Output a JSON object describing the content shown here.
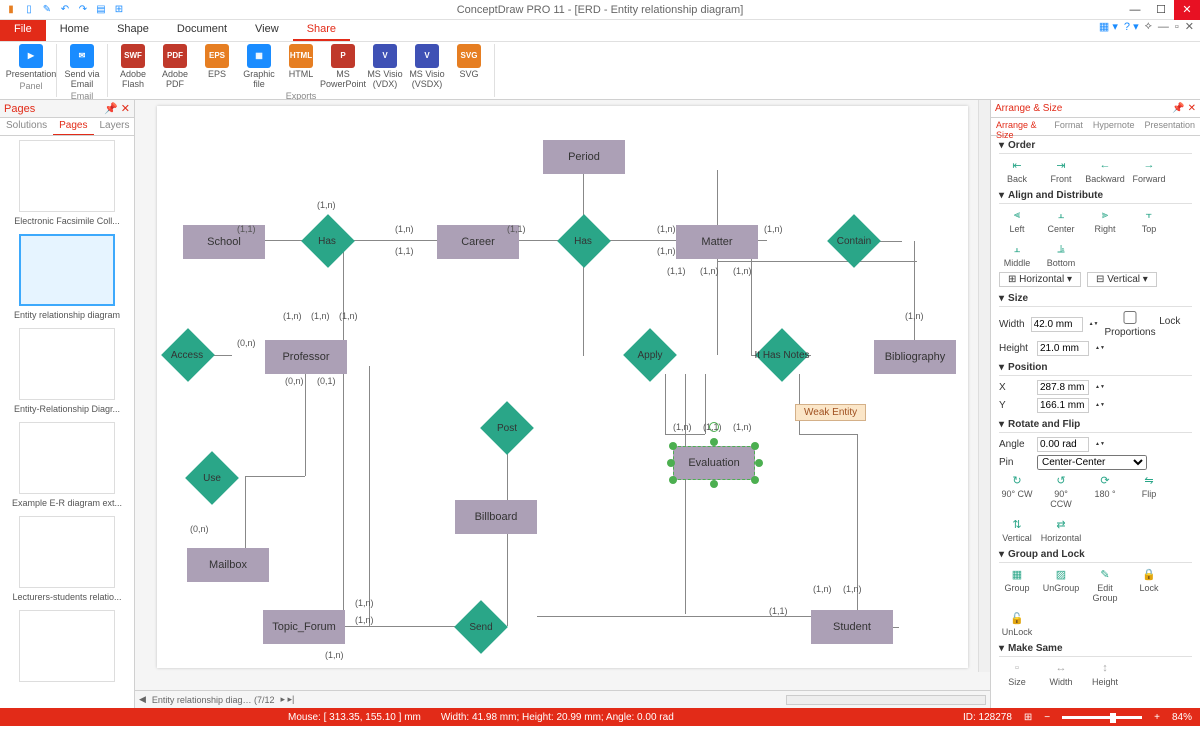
{
  "title": "ConceptDraw PRO 11 - [ERD - Entity relationship diagram]",
  "menu": {
    "file": "File",
    "home": "Home",
    "shape": "Shape",
    "document": "Document",
    "view": "View",
    "share": "Share"
  },
  "ribbon": {
    "presentation": "Presentation",
    "panel": "Panel",
    "sendemail": "Send via Email",
    "email": "Email",
    "flash": "Adobe Flash",
    "pdf": "Adobe PDF",
    "eps": "EPS",
    "graphic": "Graphic file",
    "html": "HTML",
    "ppt": "MS PowerPoint",
    "vdx": "MS Visio (VDX)",
    "vsdx": "MS Visio (VSDX)",
    "svg": "SVG",
    "exports": "Exports"
  },
  "pages": {
    "title": "Pages",
    "tabs": {
      "solutions": "Solutions",
      "pages": "Pages",
      "layers": "Layers"
    },
    "thumbs": [
      "Electronic Facsimile Coll...",
      "Entity relationship diagram",
      "Entity-Relationship Diagr...",
      "Example E-R diagram ext...",
      "Lecturers-students relatio..."
    ]
  },
  "diagram": {
    "entities": {
      "school": "School",
      "period": "Period",
      "career": "Career",
      "matter": "Matter",
      "professor": "Professor",
      "bibliography": "Bibliography",
      "evaluation": "Evaluation",
      "billboard": "Billboard",
      "mailbox": "Mailbox",
      "topic": "Topic_Forum",
      "student": "Student"
    },
    "relations": {
      "has1": "Has",
      "has2": "Has",
      "contain": "Contain",
      "access": "Access",
      "apply": "Apply",
      "ithasnotes": "It Has Notes",
      "post": "Post",
      "use": "Use",
      "send": "Send"
    },
    "tooltip": "Weak Entity",
    "htab": "Entity relationship diag… (7/12"
  },
  "arrange": {
    "title": "Arrange & Size",
    "tabs": {
      "as": "Arrange & Size",
      "fmt": "Format",
      "hyp": "Hypernote",
      "pres": "Presentation"
    },
    "order": {
      "hd": "Order",
      "back": "Back",
      "front": "Front",
      "backward": "Backward",
      "forward": "Forward"
    },
    "align": {
      "hd": "Align and Distribute",
      "left": "Left",
      "center": "Center",
      "right": "Right",
      "top": "Top",
      "middle": "Middle",
      "bottom": "Bottom",
      "horiz": "Horizontal",
      "vert": "Vertical"
    },
    "size": {
      "hd": "Size",
      "wl": "Width",
      "wv": "42.0 mm",
      "hl": "Height",
      "hv": "21.0 mm",
      "lock": "Lock Proportions"
    },
    "pos": {
      "hd": "Position",
      "xl": "X",
      "xv": "287.8 mm",
      "yl": "Y",
      "yv": "166.1 mm"
    },
    "rot": {
      "hd": "Rotate and Flip",
      "al": "Angle",
      "av": "0.00 rad",
      "pl": "Pin",
      "pv": "Center-Center",
      "cw": "90° CW",
      "ccw": "90° CCW",
      "r180": "180 °",
      "flip": "Flip",
      "v": "Vertical",
      "h": "Horizontal"
    },
    "grp": {
      "hd": "Group and Lock",
      "g": "Group",
      "ug": "UnGroup",
      "eg": "Edit Group",
      "lk": "Lock",
      "ulk": "UnLock"
    },
    "ms": {
      "hd": "Make Same",
      "s": "Size",
      "w": "Width",
      "h": "Height"
    }
  },
  "status": {
    "mouse": "Mouse: [ 313.35, 155.10 ] mm",
    "dims": "Width: 41.98 mm;  Height: 20.99 mm;  Angle: 0.00 rad",
    "id": "ID: 128278",
    "zoom": "84%"
  }
}
